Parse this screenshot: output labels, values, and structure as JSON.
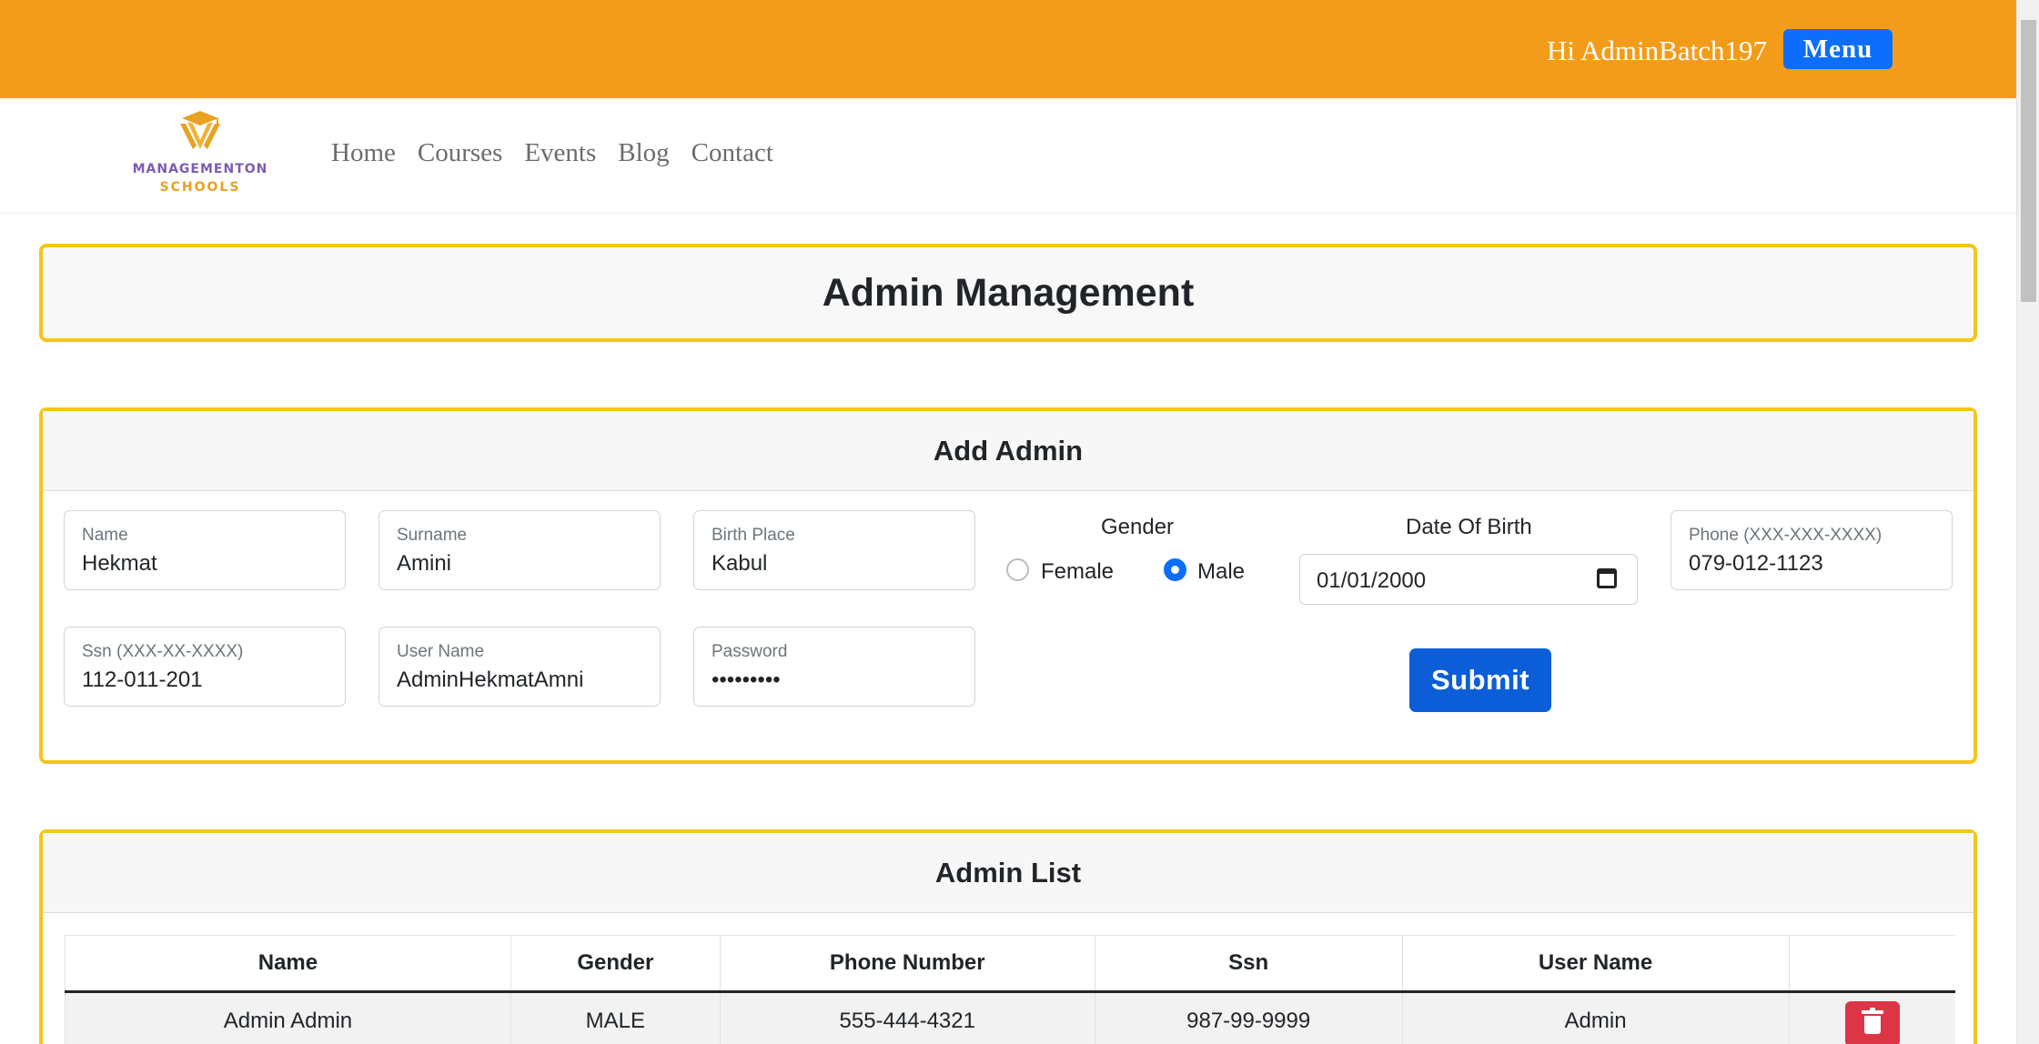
{
  "header": {
    "greeting": "Hi AdminBatch197",
    "menu_label": "Menu"
  },
  "brand": {
    "logo_line1": "MANAGEMENTON",
    "logo_line2": "SCHOOLS",
    "logo_icon": "graduation-cap-logo-icon",
    "color_orange": "#f39c1a",
    "color_accent": "#f5c518"
  },
  "nav": {
    "items": [
      "Home",
      "Courses",
      "Events",
      "Blog",
      "Contact"
    ]
  },
  "page": {
    "title": "Admin Management"
  },
  "add_admin": {
    "header": "Add Admin",
    "fields": {
      "name": {
        "label": "Name",
        "value": "Hekmat"
      },
      "surname": {
        "label": "Surname",
        "value": "Amini"
      },
      "birth_place": {
        "label": "Birth Place",
        "value": "Kabul"
      },
      "phone": {
        "label": "Phone (XXX-XXX-XXXX)",
        "value": "079-012-1123"
      },
      "ssn": {
        "label": "Ssn (XXX-XX-XXXX)",
        "value": "112-011-201"
      },
      "username": {
        "label": "User Name",
        "value": "AdminHekmatAmni"
      },
      "password": {
        "label": "Password",
        "value": "•••••••••"
      }
    },
    "gender": {
      "label": "Gender",
      "options": [
        "Female",
        "Male"
      ],
      "selected": "Male"
    },
    "dob": {
      "label": "Date Of Birth",
      "value": "01/01/2000"
    },
    "submit_label": "Submit"
  },
  "admin_list": {
    "header": "Admin List",
    "columns": [
      "Name",
      "Gender",
      "Phone Number",
      "Ssn",
      "User Name",
      ""
    ],
    "rows": [
      {
        "name": "Admin Admin",
        "gender": "MALE",
        "phone": "555-444-4321",
        "ssn": "987-99-9999",
        "username": "Admin"
      }
    ]
  }
}
